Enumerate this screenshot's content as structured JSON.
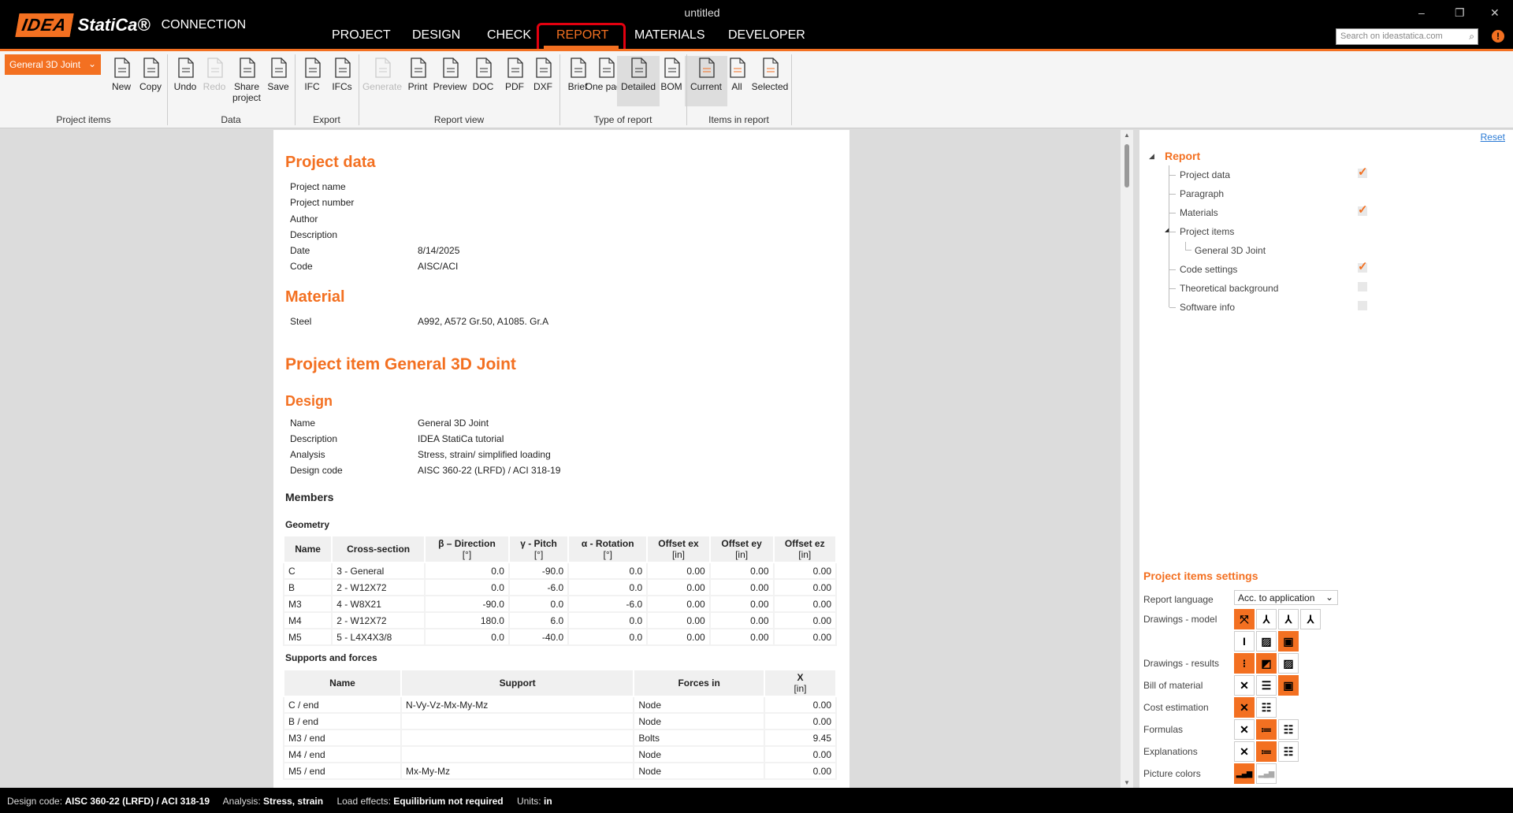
{
  "window": {
    "title": "untitled",
    "minimize": "–",
    "restore": "❐",
    "close": "✕"
  },
  "logo": {
    "idea": "IDEA",
    "statica": "StatiCa®",
    "product": "CONNECTION"
  },
  "nav": {
    "tabs": [
      "PROJECT",
      "DESIGN",
      "CHECK",
      "REPORT",
      "MATERIALS",
      "DEVELOPER"
    ],
    "active": "REPORT"
  },
  "search": {
    "placeholder": "Search on ideastatica.com"
  },
  "ribbon": {
    "project_item": "General 3D Joint",
    "groups": [
      "Project items",
      "Data",
      "Export",
      "Report view",
      "Type of report",
      "Items in report"
    ],
    "buttons": [
      {
        "label": "New",
        "icon": "new-icon"
      },
      {
        "label": "Copy",
        "icon": "copy-icon"
      },
      {
        "label": "Undo",
        "icon": "undo-icon"
      },
      {
        "label": "Redo",
        "icon": "redo-icon",
        "disabled": true
      },
      {
        "label": "Share project",
        "icon": "share-icon"
      },
      {
        "label": "Save",
        "icon": "save-icon"
      },
      {
        "label": "IFC",
        "icon": "ifc-icon"
      },
      {
        "label": "IFCs",
        "icon": "ifcs-icon"
      },
      {
        "label": "Generate",
        "icon": "generate-icon",
        "disabled": true
      },
      {
        "label": "Print",
        "icon": "print-icon"
      },
      {
        "label": "Preview",
        "icon": "preview-icon"
      },
      {
        "label": "DOC",
        "icon": "doc-icon"
      },
      {
        "label": "PDF",
        "icon": "pdf-icon"
      },
      {
        "label": "DXF",
        "icon": "dxf-icon"
      },
      {
        "label": "Brief",
        "icon": "brief-icon"
      },
      {
        "label": "One page",
        "icon": "one-page-icon"
      },
      {
        "label": "Detailed",
        "icon": "detailed-icon",
        "selected": true
      },
      {
        "label": "BOM",
        "icon": "bom-icon"
      },
      {
        "label": "Current",
        "icon": "current-icon",
        "selected": true
      },
      {
        "label": "All",
        "icon": "all-icon"
      },
      {
        "label": "Selected",
        "icon": "selected-icon"
      }
    ]
  },
  "report": {
    "project_data": {
      "title": "Project data",
      "rows": [
        [
          "Project name",
          ""
        ],
        [
          "Project number",
          ""
        ],
        [
          "Author",
          ""
        ],
        [
          "Description",
          ""
        ],
        [
          "Date",
          "8/14/2025"
        ],
        [
          "Code",
          "AISC/ACI"
        ]
      ]
    },
    "material": {
      "title": "Material",
      "rows": [
        [
          "Steel",
          "A992, A572 Gr.50, A1085. Gr.A"
        ]
      ]
    },
    "item_title": "Project item General 3D Joint",
    "design": {
      "title": "Design",
      "rows": [
        [
          "Name",
          "General 3D Joint"
        ],
        [
          "Description",
          "IDEA StatiCa tutorial"
        ],
        [
          "Analysis",
          "Stress, strain/ simplified loading"
        ],
        [
          "Design code",
          "AISC 360-22 (LRFD) / ACI 318-19"
        ]
      ]
    },
    "members_title": "Members",
    "geometry": {
      "title": "Geometry",
      "headers": [
        [
          "Name",
          ""
        ],
        [
          "Cross-section",
          ""
        ],
        [
          "β – Direction",
          "[°]"
        ],
        [
          "γ - Pitch",
          "[°]"
        ],
        [
          "α - Rotation",
          "[°]"
        ],
        [
          "Offset ex",
          "[in]"
        ],
        [
          "Offset ey",
          "[in]"
        ],
        [
          "Offset ez",
          "[in]"
        ]
      ],
      "rows": [
        [
          "C",
          "3 - General",
          "0.0",
          "-90.0",
          "0.0",
          "0.00",
          "0.00",
          "0.00"
        ],
        [
          "B",
          "2 - W12X72",
          "0.0",
          "-6.0",
          "0.0",
          "0.00",
          "0.00",
          "0.00"
        ],
        [
          "M3",
          "4 - W8X21",
          "-90.0",
          "0.0",
          "-6.0",
          "0.00",
          "0.00",
          "0.00"
        ],
        [
          "M4",
          "2 - W12X72",
          "180.0",
          "6.0",
          "0.0",
          "0.00",
          "0.00",
          "0.00"
        ],
        [
          "M5",
          "5 - L4X4X3/8",
          "0.0",
          "-40.0",
          "0.0",
          "0.00",
          "0.00",
          "0.00"
        ]
      ]
    },
    "supports": {
      "title": "Supports and forces",
      "headers": [
        [
          "Name",
          ""
        ],
        [
          "Support",
          ""
        ],
        [
          "Forces in",
          ""
        ],
        [
          "X",
          "[in]"
        ]
      ],
      "rows": [
        [
          "C / end",
          "N-Vy-Vz-Mx-My-Mz",
          "Node",
          "0.00"
        ],
        [
          "B / end",
          "",
          "Node",
          "0.00"
        ],
        [
          "M3 / end",
          "",
          "Bolts",
          "9.45"
        ],
        [
          "M4 / end",
          "",
          "Node",
          "0.00"
        ],
        [
          "M5 / end",
          "Mx-My-Mz",
          "Node",
          "0.00"
        ]
      ]
    }
  },
  "panel": {
    "reset": "Reset",
    "tree_root": "Report",
    "tree": [
      {
        "label": "Project data",
        "checked": true
      },
      {
        "label": "Paragraph"
      },
      {
        "label": "Materials",
        "checked": true
      },
      {
        "label": "Project items",
        "expanded": true
      },
      {
        "label": "General 3D Joint",
        "child": true
      },
      {
        "label": "Code settings",
        "checked": true
      },
      {
        "label": "Theoretical background",
        "checked": false
      },
      {
        "label": "Software info",
        "checked": false
      }
    ],
    "settings_title": "Project items settings",
    "language_label": "Report language",
    "language_value": "Acc. to application",
    "rows": [
      {
        "label": "Drawings - model",
        "icons": [
          [
            "3d-view-icon",
            1
          ],
          [
            "x-axis-view-icon",
            0
          ],
          [
            "y-axis-view-icon",
            0
          ],
          [
            "z-axis-view-icon",
            0
          ]
        ]
      },
      {
        "label": "",
        "icons": [
          [
            "section-icon",
            0
          ],
          [
            "picture-icon",
            0
          ],
          [
            "picture-highlight-icon",
            1
          ]
        ]
      },
      {
        "label": "Drawings - results",
        "icons": [
          [
            "traffic-light-icon",
            1
          ],
          [
            "stress-icon",
            1
          ],
          [
            "picture-icon",
            0
          ]
        ]
      },
      {
        "label": "Bill of material",
        "icons": [
          [
            "none-icon",
            0
          ],
          [
            "table-icon",
            0
          ],
          [
            "picture-highlight-icon",
            1
          ]
        ]
      },
      {
        "label": "Cost estimation",
        "icons": [
          [
            "none-icon",
            1
          ],
          [
            "list-icon",
            0
          ]
        ]
      },
      {
        "label": "Formulas",
        "icons": [
          [
            "none-icon",
            0
          ],
          [
            "brief-list-icon",
            1
          ],
          [
            "list-icon",
            0
          ]
        ]
      },
      {
        "label": "Explanations",
        "icons": [
          [
            "none-icon",
            0
          ],
          [
            "brief-list-icon",
            1
          ],
          [
            "list-icon",
            0
          ]
        ]
      },
      {
        "label": "Picture colors",
        "icons": [
          [
            "color-bars-icon",
            1
          ],
          [
            "gray-bars-icon",
            0
          ]
        ]
      }
    ]
  },
  "status": {
    "design_code_label": "Design code:",
    "design_code": "AISC 360-22 (LRFD) / ACI 318-19",
    "analysis_label": "Analysis:",
    "analysis": "Stress, strain",
    "load_label": "Load effects:",
    "load": "Equilibrium not required",
    "units_label": "Units:",
    "units": "in"
  },
  "colors": {
    "accent": "#f37021",
    "highlight": "#e3000f",
    "link": "#2a7ad5"
  }
}
